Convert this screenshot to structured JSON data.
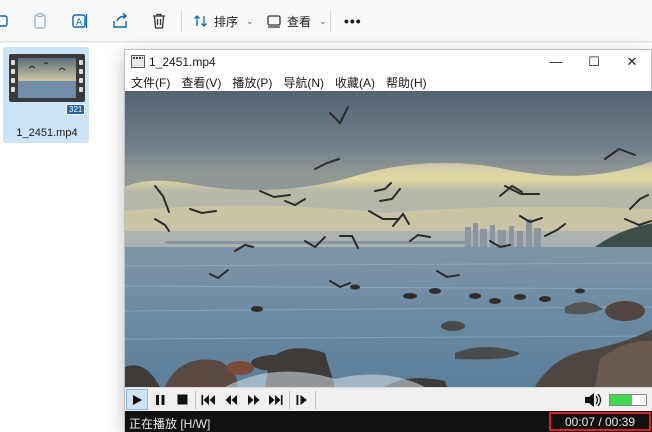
{
  "toolbar": {
    "sort_label": "排序",
    "view_label": "查看",
    "more_label": "•••"
  },
  "file": {
    "name": "1_2451.mp4",
    "badge": "321"
  },
  "player": {
    "title": "1_2451.mp4",
    "menu": [
      "文件(F)",
      "查看(V)",
      "播放(P)",
      "导航(N)",
      "收藏(A)",
      "帮助(H)"
    ],
    "status": "正在播放 [H/W]",
    "time": "00:07 / 00:39",
    "volume_fraction": 0.6,
    "minimize": "—",
    "maximize": "☐",
    "close": "✕"
  },
  "colors": {
    "selection": "#cce4f7",
    "volume": "#3fd84a",
    "highlight_border": "#e12020"
  }
}
